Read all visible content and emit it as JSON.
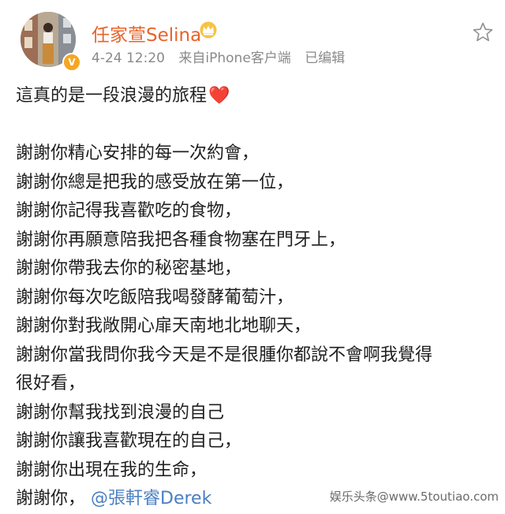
{
  "header": {
    "user_name": "任家萱Selina",
    "timestamp": "4-24 12:20",
    "source": "来自iPhone客户端",
    "edited": "已编辑",
    "verified_icon": "vip-crown-icon"
  },
  "post": {
    "title_line": "這真的是一段浪漫的旅程",
    "emoji": "❤️",
    "lines": [
      "謝謝你精心安排的每一次約會，",
      "謝謝你總是把我的感受放在第一位，",
      "謝謝你記得我喜歡吃的食物，",
      "謝謝你再願意陪我把各種食物塞在門牙上，",
      "謝謝你帶我去你的秘密基地，",
      "謝謝你每次吃飯陪我喝發酵葡萄汁，",
      "謝謝你對我敞開心扉天南地北地聊天，",
      "謝謝你當我問你我今天是不是很腫你都說不會啊我覺得",
      "很好看，",
      "謝謝你幫我找到浪漫的自己",
      "謝謝你讓我喜歡現在的自己，",
      "謝謝你出現在我的生命，"
    ],
    "last_line_prefix": "謝謝你，",
    "mention": "@張軒睿Derek"
  },
  "watermark": "娱乐头条@www.5toutiao.com"
}
